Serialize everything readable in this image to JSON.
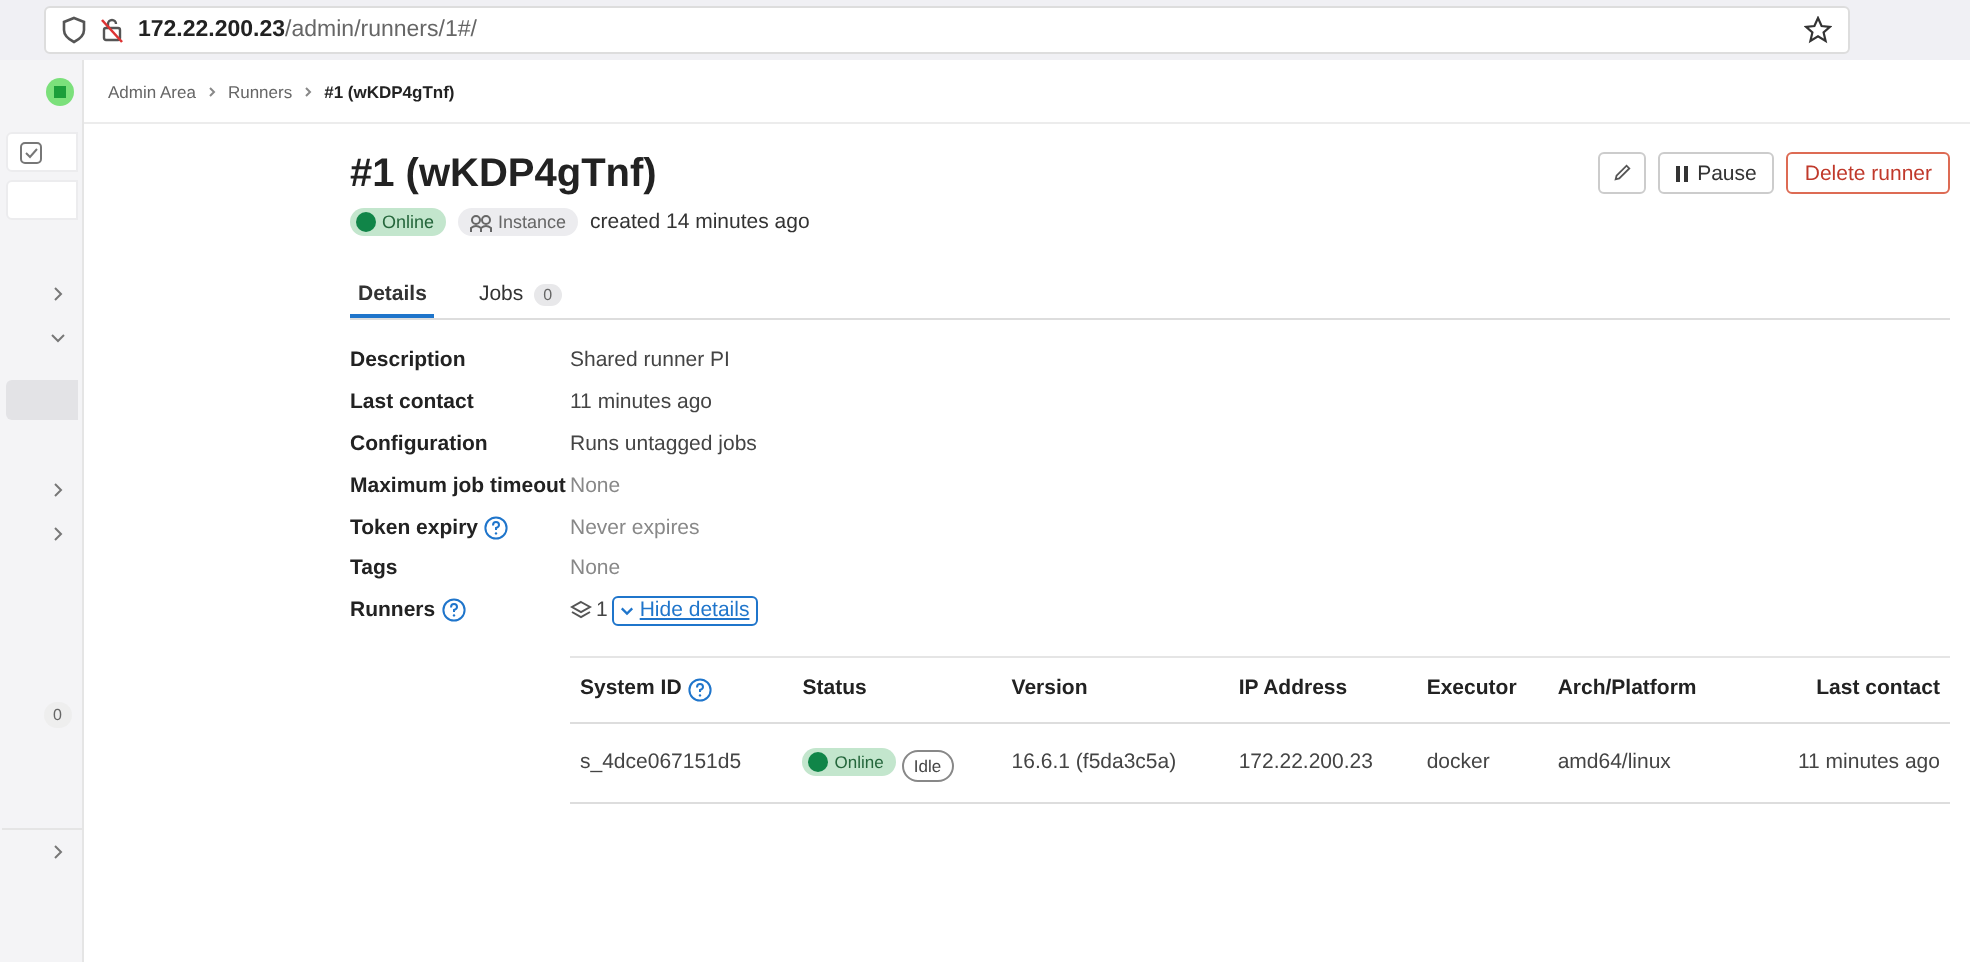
{
  "browser": {
    "url_host": "172.22.200.23",
    "url_path": "/admin/runners/1#/"
  },
  "sidebar": {
    "items": [
      {
        "kind": "icon",
        "selected": false
      },
      {
        "kind": "blank",
        "selected": false
      },
      {
        "kind": "chevron",
        "expanded": false,
        "selected": false
      },
      {
        "kind": "chevron",
        "expanded": true,
        "selected": false
      },
      {
        "kind": "blank",
        "selected": true
      },
      {
        "kind": "chevron",
        "expanded": false,
        "selected": false
      },
      {
        "kind": "chevron",
        "expanded": false,
        "selected": false
      },
      {
        "kind": "badge",
        "badge": "0",
        "selected": false
      },
      {
        "kind": "chevron",
        "expanded": false,
        "selected": false
      }
    ]
  },
  "breadcrumbs": [
    "Admin Area",
    "Runners",
    "#1 (wKDP4gTnf)"
  ],
  "title": "#1 (wKDP4gTnf)",
  "status_badge": "Online",
  "type_badge": "Instance",
  "created": "created 14 minutes ago",
  "actions": {
    "pause": "Pause",
    "delete": "Delete runner"
  },
  "tabs": [
    {
      "label": "Details",
      "selected": true
    },
    {
      "label": "Jobs",
      "count": "0",
      "selected": false
    }
  ],
  "details": [
    {
      "label": "Description",
      "value": "Shared runner PI",
      "muted": false,
      "help": false
    },
    {
      "label": "Last contact",
      "value": "11 minutes ago",
      "muted": false,
      "help": false
    },
    {
      "label": "Configuration",
      "value": "Runs untagged jobs",
      "muted": false,
      "help": false
    },
    {
      "label": "Maximum job timeout",
      "value": "None",
      "muted": true,
      "help": false
    },
    {
      "label": "Token expiry",
      "value": "Never expires",
      "muted": true,
      "help": true
    },
    {
      "label": "Tags",
      "value": "None",
      "muted": true,
      "help": false
    }
  ],
  "runners": {
    "label": "Runners",
    "count": "1",
    "toggle": "Hide details",
    "expanded": true
  },
  "table": {
    "columns": [
      "System ID",
      "Status",
      "Version",
      "IP Address",
      "Executor",
      "Arch/Platform",
      "Last contact"
    ],
    "rows": [
      {
        "system_id": "s_4dce067151d5",
        "status": "Online",
        "state": "Idle",
        "version": "16.6.1 (f5da3c5a)",
        "ip": "172.22.200.23",
        "executor": "docker",
        "arch": "amd64/linux",
        "last_contact": "11 minutes ago"
      }
    ]
  }
}
